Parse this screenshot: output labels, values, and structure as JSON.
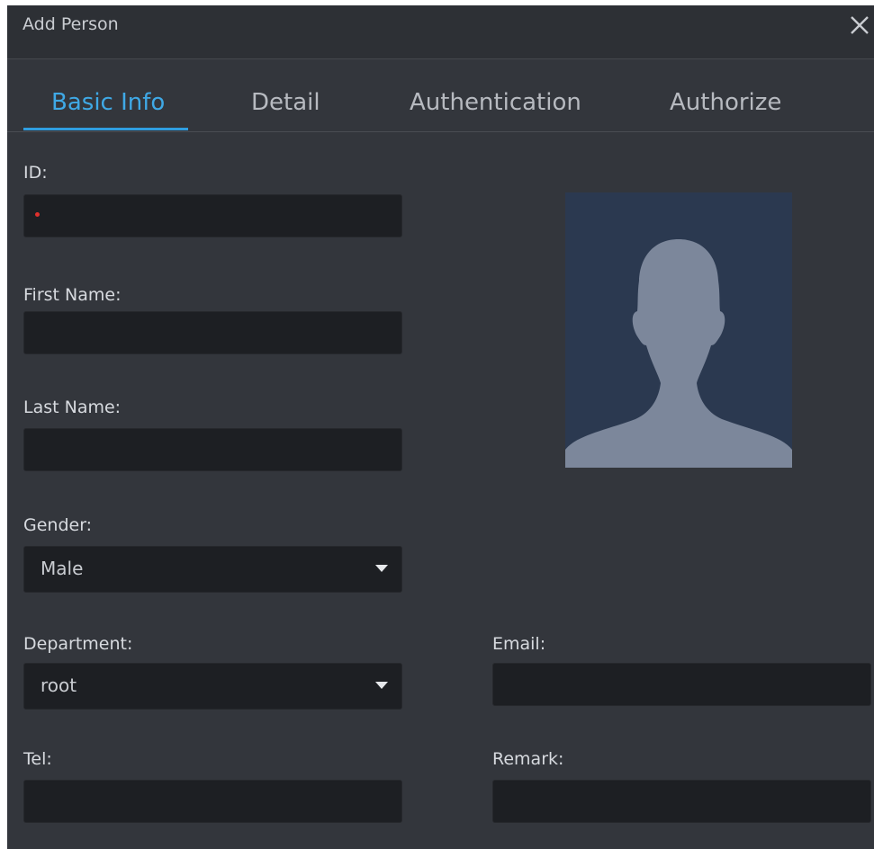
{
  "dialog": {
    "title": "Add Person",
    "close_icon": "close-icon"
  },
  "tabs": [
    {
      "label": "Basic Info",
      "active": true
    },
    {
      "label": "Detail",
      "active": false
    },
    {
      "label": "Authentication",
      "active": false
    },
    {
      "label": "Authorize",
      "active": false
    }
  ],
  "form": {
    "id": {
      "label": "ID:",
      "value": "",
      "required": true
    },
    "first_name": {
      "label": "First Name:",
      "value": ""
    },
    "last_name": {
      "label": "Last Name:",
      "value": ""
    },
    "gender": {
      "label": "Gender:",
      "value": "Male"
    },
    "department": {
      "label": "Department:",
      "value": "root"
    },
    "email": {
      "label": "Email:",
      "value": ""
    },
    "tel": {
      "label": "Tel:",
      "value": ""
    },
    "remark": {
      "label": "Remark:",
      "value": ""
    }
  },
  "photo": {
    "icon": "person-silhouette-icon"
  },
  "colors": {
    "accent": "#3fa9e6",
    "background": "#33363c",
    "input_bg": "#1d1f23",
    "required_marker": "#e0302c",
    "photo_bg": "#2b3950",
    "silhouette": "#7c879b"
  }
}
